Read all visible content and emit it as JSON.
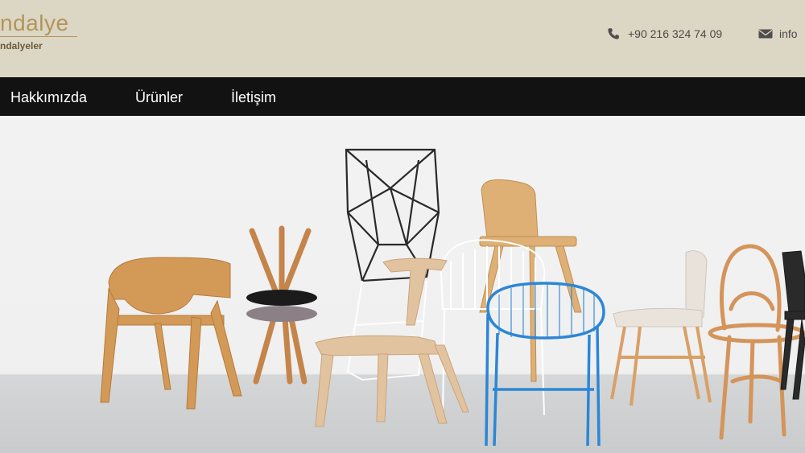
{
  "header": {
    "logo_text": "ndalye",
    "logo_subtitle": "ndalyeler",
    "phone": "+90 216 324 74 09",
    "email": "info",
    "phone_icon": "phone-icon",
    "email_icon": "envelope-icon"
  },
  "nav": {
    "items": [
      {
        "label": "Hakkımızda"
      },
      {
        "label": "Ürünler"
      },
      {
        "label": "İletişim"
      }
    ]
  },
  "hero": {
    "image_subject": "chairs-showcase"
  },
  "colors": {
    "header_bg": "#dcd6c4",
    "logo_gold": "#b3955a",
    "nav_bg": "#121212",
    "nav_text": "#ffffff"
  }
}
